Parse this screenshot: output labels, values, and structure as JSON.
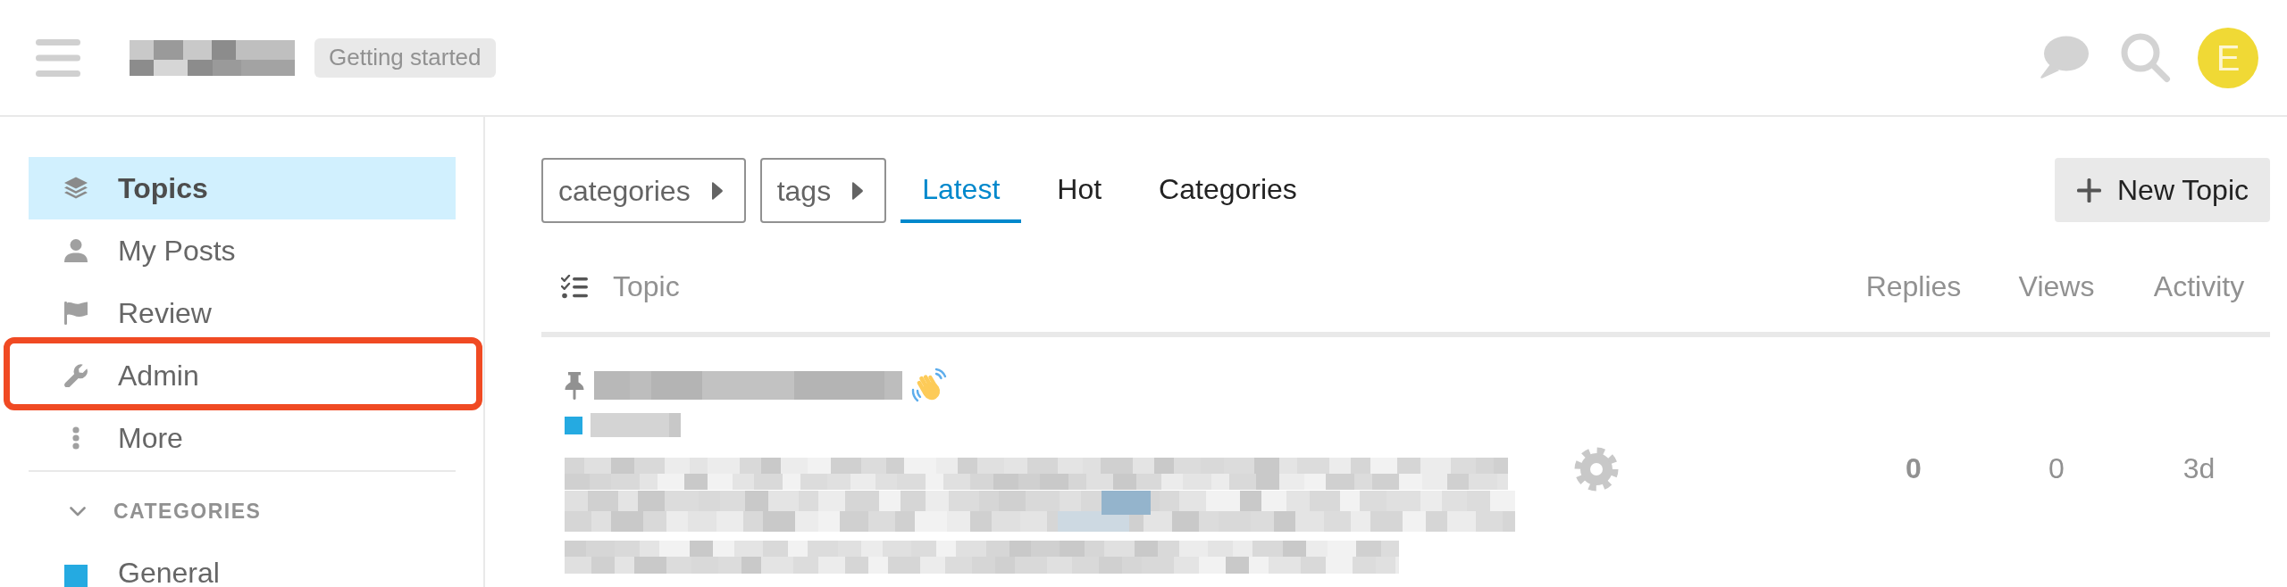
{
  "header": {
    "tag": "Getting started",
    "avatar_letter": "E"
  },
  "sidebar": {
    "items": [
      {
        "label": "Topics",
        "selected": true,
        "highlighted": false
      },
      {
        "label": "My Posts",
        "selected": false,
        "highlighted": false
      },
      {
        "label": "Review",
        "selected": false,
        "highlighted": false
      },
      {
        "label": "Admin",
        "selected": false,
        "highlighted": true
      },
      {
        "label": "More",
        "selected": false,
        "highlighted": false
      }
    ],
    "section": {
      "title": "CATEGORIES",
      "expanded": true,
      "items": [
        {
          "name": "General",
          "color": "#25aae1"
        }
      ]
    }
  },
  "navigation": {
    "dropdowns": [
      {
        "label": "categories"
      },
      {
        "label": "tags"
      }
    ],
    "tabs": [
      {
        "label": "Latest",
        "selected": true
      },
      {
        "label": "Hot",
        "selected": false
      },
      {
        "label": "Categories",
        "selected": false
      }
    ],
    "new_topic_button": "New Topic"
  },
  "topic_list": {
    "columns": [
      "Topic",
      "Replies",
      "Views",
      "Activity"
    ],
    "rows": [
      {
        "pinned": true,
        "category": {
          "color": "#25aae1"
        },
        "replies": "0",
        "views": "0",
        "activity": "3d"
      }
    ]
  }
}
